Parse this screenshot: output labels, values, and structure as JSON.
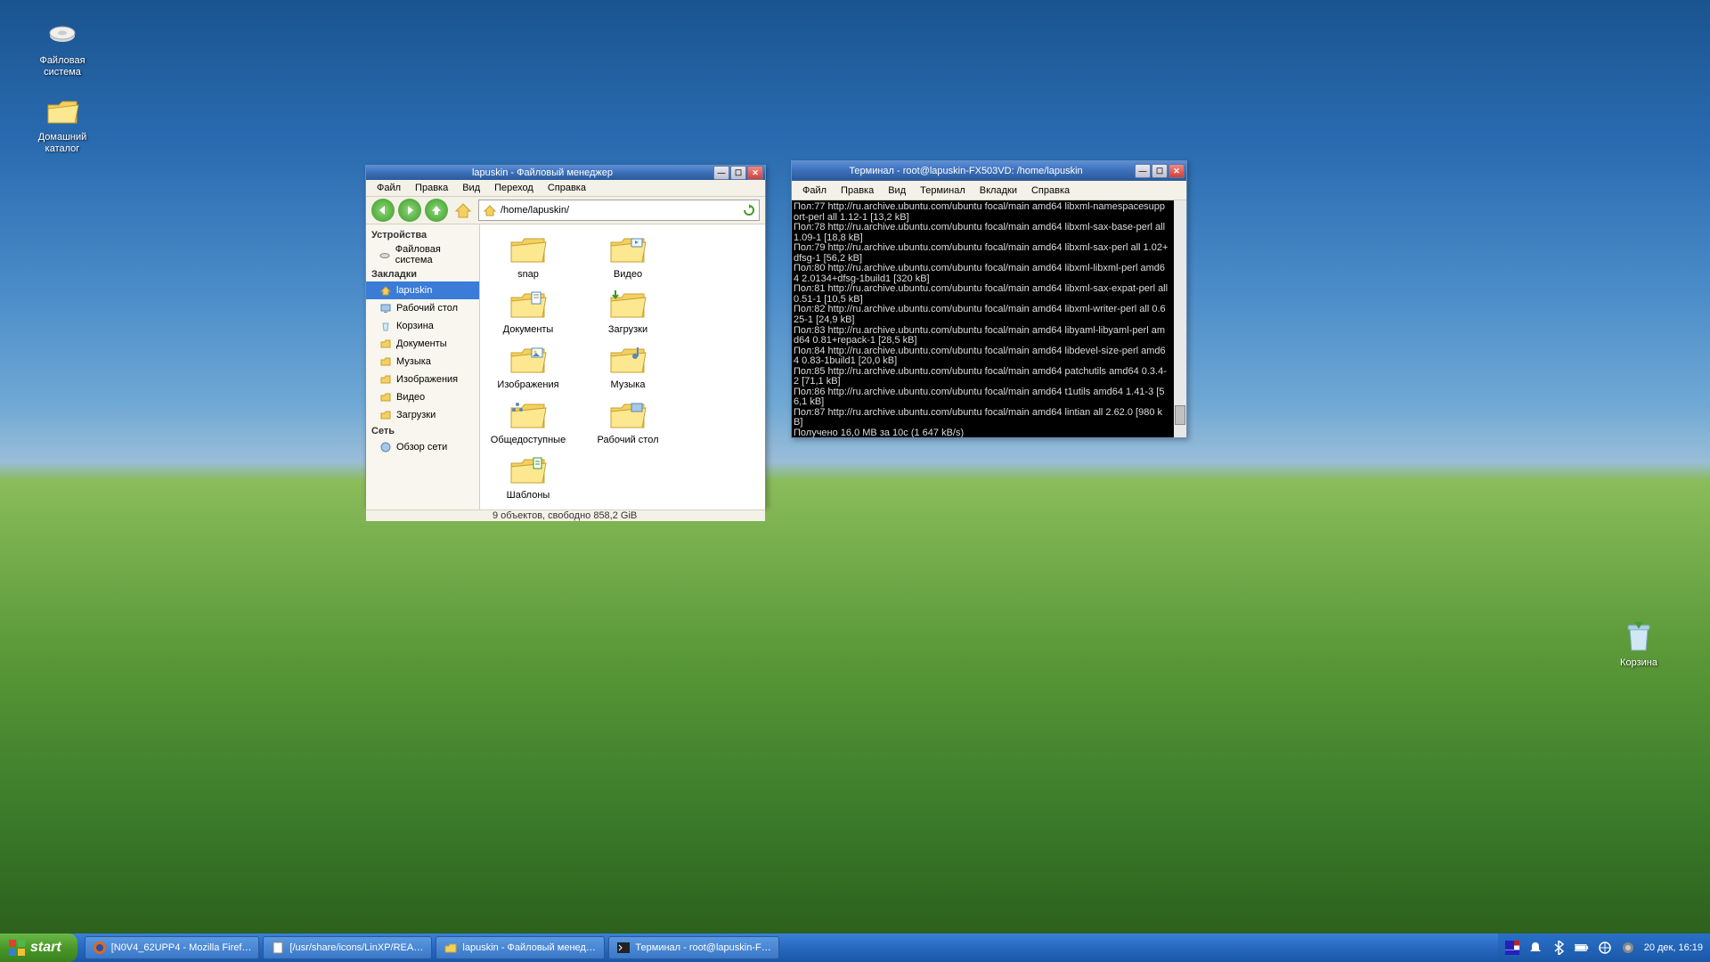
{
  "desktop": {
    "icons": [
      {
        "name": "filesystem-icon",
        "label": "Файловая\nсистема"
      },
      {
        "name": "home-folder-icon",
        "label": "Домашний\nкаталог"
      }
    ],
    "trash": {
      "label": "Корзина"
    }
  },
  "file_manager": {
    "title": "lapuskin - Файловый менеджер",
    "menus": [
      "Файл",
      "Правка",
      "Вид",
      "Переход",
      "Справка"
    ],
    "path": "/home/lapuskin/",
    "sidebar": {
      "sections": [
        {
          "header": "Устройства",
          "items": [
            {
              "label": "Файловая система",
              "icon": "drive"
            }
          ]
        },
        {
          "header": "Закладки",
          "items": [
            {
              "label": "lapuskin",
              "icon": "home",
              "selected": true
            },
            {
              "label": "Рабочий стол",
              "icon": "desktop"
            },
            {
              "label": "Корзина",
              "icon": "trash"
            },
            {
              "label": "Документы",
              "icon": "folder"
            },
            {
              "label": "Музыка",
              "icon": "folder"
            },
            {
              "label": "Изображения",
              "icon": "folder"
            },
            {
              "label": "Видео",
              "icon": "folder"
            },
            {
              "label": "Загрузки",
              "icon": "folder"
            }
          ]
        },
        {
          "header": "Сеть",
          "items": [
            {
              "label": "Обзор сети",
              "icon": "network"
            }
          ]
        }
      ]
    },
    "grid": [
      {
        "label": "snap",
        "overlay": ""
      },
      {
        "label": "Видео",
        "overlay": "video"
      },
      {
        "label": "Документы",
        "overlay": "doc"
      },
      {
        "label": "Загрузки",
        "overlay": "download"
      },
      {
        "label": "Изображения",
        "overlay": "image"
      },
      {
        "label": "Музыка",
        "overlay": "music"
      },
      {
        "label": "Общедоступные",
        "overlay": "share"
      },
      {
        "label": "Рабочий стол",
        "overlay": "desktop"
      },
      {
        "label": "Шаблоны",
        "overlay": "template"
      }
    ],
    "status": "9 объектов, свободно 858,2 GiB"
  },
  "terminal": {
    "title": "Терминал - root@lapuskin-FX503VD: /home/lapuskin",
    "menus": [
      "Файл",
      "Правка",
      "Вид",
      "Терминал",
      "Вкладки",
      "Справка"
    ],
    "lines": [
      "Пол:77 http://ru.archive.ubuntu.com/ubuntu focal/main amd64 libxml-namespacesupport-perl all 1.12-1 [13,2 kB]",
      "Пол:78 http://ru.archive.ubuntu.com/ubuntu focal/main amd64 libxml-sax-base-perl all 1.09-1 [18,8 kB]",
      "Пол:79 http://ru.archive.ubuntu.com/ubuntu focal/main amd64 libxml-sax-perl all 1.02+dfsg-1 [56,2 kB]",
      "Пол:80 http://ru.archive.ubuntu.com/ubuntu focal/main amd64 libxml-libxml-perl amd64 2.0134+dfsg-1build1 [320 kB]",
      "Пол:81 http://ru.archive.ubuntu.com/ubuntu focal/main amd64 libxml-sax-expat-perl all 0.51-1 [10,5 kB]",
      "Пол:82 http://ru.archive.ubuntu.com/ubuntu focal/main amd64 libxml-writer-perl all 0.625-1 [24,9 kB]",
      "Пол:83 http://ru.archive.ubuntu.com/ubuntu focal/main amd64 libyaml-libyaml-perl amd64 0.81+repack-1 [28,5 kB]",
      "Пол:84 http://ru.archive.ubuntu.com/ubuntu focal/main amd64 libdevel-size-perl amd64 0.83-1build1 [20,0 kB]",
      "Пол:85 http://ru.archive.ubuntu.com/ubuntu focal/main amd64 patchutils amd64 0.3.4-2 [71,1 kB]",
      "Пол:86 http://ru.archive.ubuntu.com/ubuntu focal/main amd64 t1utils amd64 1.41-3 [56,1 kB]",
      "Пол:87 http://ru.archive.ubuntu.com/ubuntu focal/main amd64 lintian all 2.62.0 [980 kB]",
      "Получено 16,0 MB за 10с (1 647 kB/s)",
      "▯"
    ]
  },
  "taskbar": {
    "start": "start",
    "items": [
      {
        "icon": "firefox",
        "label": "[N0V4_62UPP4 - Mozilla Firef…"
      },
      {
        "icon": "text",
        "label": "[/usr/share/icons/LinXP/REA…"
      },
      {
        "icon": "folder",
        "label": "lapuskin - Файловый менед…"
      },
      {
        "icon": "terminal",
        "label": "Терминал - root@lapuskin-F…"
      }
    ],
    "clock": "20 дек, 16:19"
  }
}
